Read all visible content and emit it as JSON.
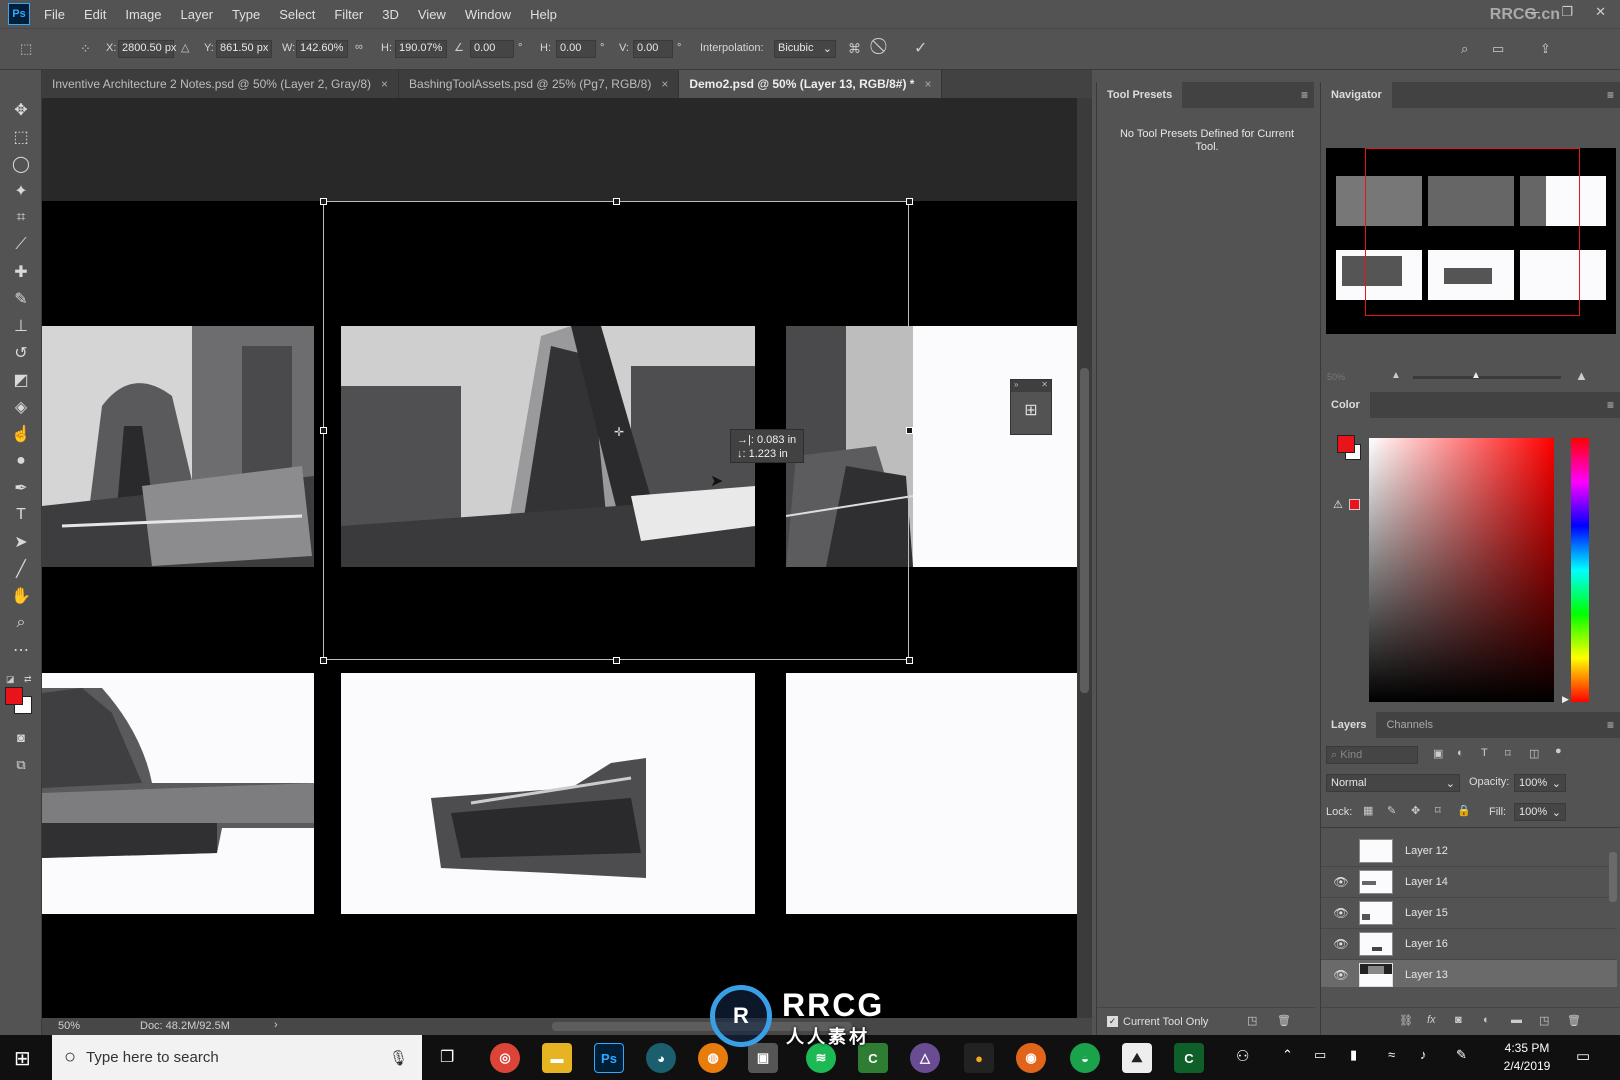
{
  "app": {
    "logo": "Ps",
    "watermark_corner": "RRCG.cn"
  },
  "menu": [
    "File",
    "Edit",
    "Image",
    "Layer",
    "Type",
    "Select",
    "Filter",
    "3D",
    "View",
    "Window",
    "Help"
  ],
  "options": {
    "x_label": "X:",
    "x_value": "2800.50 px",
    "y_label": "Y:",
    "y_value": "861.50 px",
    "w_label": "W:",
    "w_value": "142.60%",
    "h_label": "H:",
    "h_value": "190.07%",
    "angle_value": "0.00",
    "hskew_label": "H:",
    "hskew_value": "0.00",
    "vskew_label": "V:",
    "vskew_value": "0.00",
    "interp_label": "Interpolation:",
    "interp_value": "Bicubic"
  },
  "tabs": [
    {
      "label": "Inventive Architecture 2 Notes.psd @ 50% (Layer 2, Gray/8)",
      "close": "×"
    },
    {
      "label": "BashingToolAssets.psd @ 25% (Pg7, RGB/8)",
      "close": "×"
    },
    {
      "label": "Demo2.psd @ 50% (Layer 13, RGB/8#) *",
      "close": "×"
    }
  ],
  "canvas": {
    "transform_readout_h": "0.083 in",
    "transform_readout_v": "1.223 in",
    "readout_h_icon": "→|:",
    "readout_v_icon": "↓:"
  },
  "status": {
    "zoom": "50%",
    "doc": "Doc: 48.2M/92.5M",
    "arrow": "›"
  },
  "tool_presets": {
    "title": "Tool Presets",
    "message": "No Tool Presets Defined for Current Tool.",
    "current_tool_only": "Current Tool Only"
  },
  "navigator": {
    "title": "Navigator",
    "zoom": "50%"
  },
  "color": {
    "title": "Color",
    "fg": "#e8141a",
    "bg": "#ffffff"
  },
  "layers": {
    "tabs": [
      "Layers",
      "Channels"
    ],
    "kind_placeholder": "Kind",
    "blend_mode": "Normal",
    "opacity_label": "Opacity:",
    "opacity_value": "100%",
    "lock_label": "Lock:",
    "fill_label": "Fill:",
    "fill_value": "100%",
    "items": [
      {
        "name": "Layer 12",
        "visible": false,
        "selected": false
      },
      {
        "name": "Layer 14",
        "visible": true,
        "selected": false
      },
      {
        "name": "Layer 15",
        "visible": true,
        "selected": false
      },
      {
        "name": "Layer 16",
        "visible": true,
        "selected": false
      },
      {
        "name": "Layer 13",
        "visible": true,
        "selected": true
      }
    ]
  },
  "taskbar": {
    "search_placeholder": "Type here to search",
    "time": "4:35 PM",
    "date": "2/4/2019"
  },
  "overlay": {
    "watermark_title": "RRCG",
    "watermark_sub": "人人素材"
  }
}
